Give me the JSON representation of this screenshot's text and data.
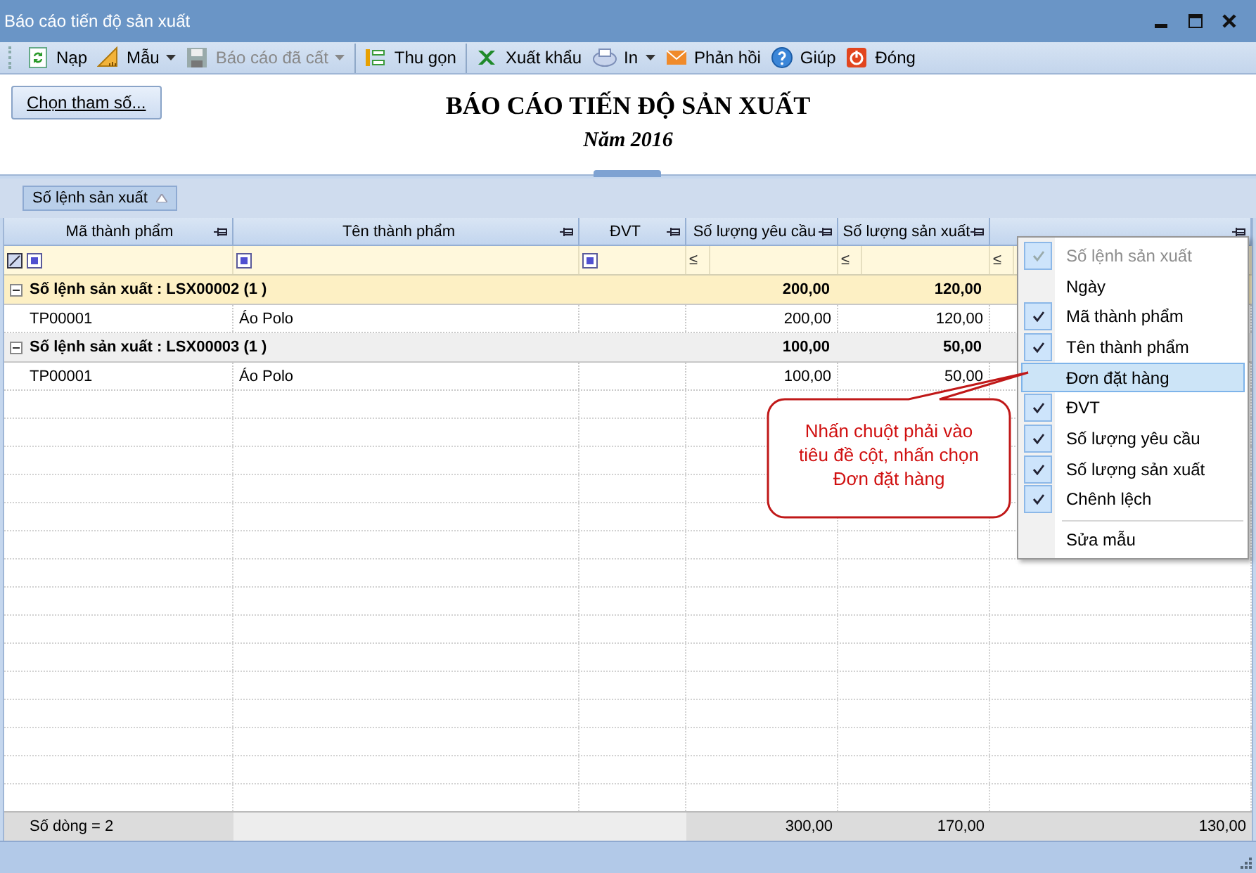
{
  "window": {
    "title": "Báo cáo tiến độ sản xuất"
  },
  "toolbar": [
    {
      "label": "Nạp",
      "dropdown": false,
      "disabled": false,
      "separator_before": false
    },
    {
      "label": "Mẫu",
      "dropdown": true,
      "disabled": false,
      "separator_before": false
    },
    {
      "label": "Báo cáo đã cất",
      "dropdown": true,
      "disabled": true,
      "separator_before": false
    },
    {
      "label": "Thu gọn",
      "dropdown": false,
      "disabled": false,
      "separator_before": true
    },
    {
      "label": "Xuất khẩu",
      "dropdown": false,
      "disabled": false,
      "separator_before": true
    },
    {
      "label": "In",
      "dropdown": true,
      "disabled": false,
      "separator_before": false
    },
    {
      "label": "Phản hồi",
      "dropdown": false,
      "disabled": false,
      "separator_before": false
    },
    {
      "label": "Giúp",
      "dropdown": false,
      "disabled": false,
      "separator_before": false
    },
    {
      "label": "Đóng",
      "dropdown": false,
      "disabled": false,
      "separator_before": false
    }
  ],
  "report": {
    "parameter_button": "Chọn tham số...",
    "title": "BÁO CÁO TIẾN ĐỘ SẢN XUẤT",
    "subtitle": "Năm 2016"
  },
  "group_panel": {
    "chip": "Số lệnh sản xuất"
  },
  "table": {
    "columns": [
      {
        "label": "Mã thành phẩm",
        "filter": {
          "kind": "checkbox",
          "checked": true
        }
      },
      {
        "label": "Tên thành phẩm",
        "filter": {
          "kind": "checkbox",
          "checked": true
        }
      },
      {
        "label": "ĐVT",
        "filter": {
          "kind": "checkbox",
          "checked": true
        }
      },
      {
        "label": "Số lượng yêu cầu",
        "filter": {
          "kind": "operator",
          "text": "≤"
        }
      },
      {
        "label": "Số lượng sản xuất",
        "filter": {
          "kind": "operator",
          "text": "≤"
        }
      },
      {
        "filter": {
          "kind": "operator",
          "text": "≤"
        }
      }
    ],
    "groups": [
      {
        "label": "Số lệnh sản xuất : LSX00002 (1 )",
        "selected": true,
        "expanded": true,
        "totals": [
          "200,00",
          "120,00"
        ],
        "rows": [
          {
            "cells": [
              "TP00001",
              "Áo Polo",
              null,
              "200,00",
              "120,00"
            ]
          }
        ]
      },
      {
        "label": "Số lệnh sản xuất : LSX00003 (1 )",
        "selected": false,
        "expanded": true,
        "totals": [
          "100,00",
          "50,00"
        ],
        "rows": [
          {
            "cells": [
              "TP00001",
              "Áo Polo",
              null,
              "100,00",
              "50,00"
            ]
          }
        ]
      }
    ],
    "footer": {
      "summary": "Số dòng = 2",
      "totals": [
        "300,00",
        "170,00",
        "130,00"
      ]
    }
  },
  "column_menu": {
    "items": [
      {
        "label": "Số lệnh sản xuất",
        "checked": true,
        "disabled": true,
        "hovered": false,
        "separator_before": false
      },
      {
        "label": "Ngày",
        "checked": false,
        "disabled": false,
        "hovered": false,
        "separator_before": false
      },
      {
        "label": "Mã thành phẩm",
        "checked": true,
        "disabled": false,
        "hovered": false,
        "separator_before": false
      },
      {
        "label": "Tên thành phẩm",
        "checked": true,
        "disabled": false,
        "hovered": false,
        "separator_before": false
      },
      {
        "label": "Đơn đặt hàng",
        "checked": false,
        "disabled": false,
        "hovered": true,
        "separator_before": false
      },
      {
        "label": "ĐVT",
        "checked": true,
        "disabled": false,
        "hovered": false,
        "separator_before": false
      },
      {
        "label": "Số lượng yêu cầu",
        "checked": true,
        "disabled": false,
        "hovered": false,
        "separator_before": false
      },
      {
        "label": "Số lượng sản xuất",
        "checked": true,
        "disabled": false,
        "hovered": false,
        "separator_before": false
      },
      {
        "label": "Chênh lệch",
        "checked": true,
        "disabled": false,
        "hovered": false,
        "separator_before": false
      },
      {
        "label": "Sửa mẫu",
        "checked": false,
        "disabled": false,
        "hovered": false,
        "separator_before": true
      }
    ]
  },
  "callout": {
    "text": "Nhấn chuột phải vào tiêu đề cột, nhấn chọn Đơn đặt hàng"
  }
}
